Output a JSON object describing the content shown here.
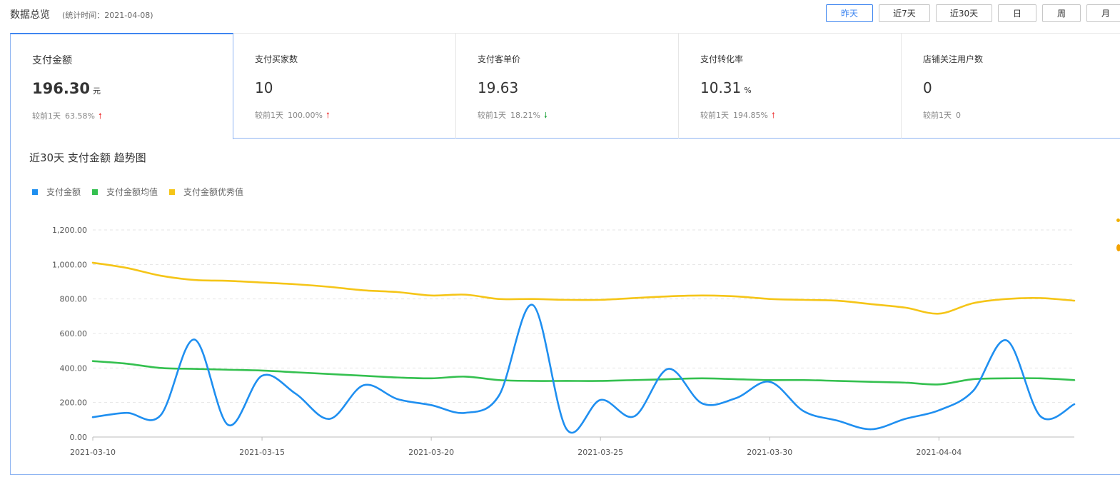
{
  "header": {
    "title": "数据总览",
    "subtitle": "(统计时间：2021-04-08)"
  },
  "range_buttons": [
    {
      "label": "昨天",
      "active": true
    },
    {
      "label": "近7天",
      "active": false
    },
    {
      "label": "近30天",
      "active": false
    },
    {
      "label": "日",
      "active": false
    },
    {
      "label": "周",
      "active": false
    },
    {
      "label": "月",
      "active": false
    }
  ],
  "metrics": [
    {
      "label": "支付金额",
      "value": "196.30",
      "unit": "元",
      "compare_label": "较前1天",
      "compare_value": "63.58%",
      "trend": "up",
      "active": true
    },
    {
      "label": "支付买家数",
      "value": "10",
      "unit": "",
      "compare_label": "较前1天",
      "compare_value": "100.00%",
      "trend": "up",
      "active": false
    },
    {
      "label": "支付客单价",
      "value": "19.63",
      "unit": "",
      "compare_label": "较前1天",
      "compare_value": "18.21%",
      "trend": "down",
      "active": false
    },
    {
      "label": "支付转化率",
      "value": "10.31",
      "unit": "%",
      "compare_label": "较前1天",
      "compare_value": "194.85%",
      "trend": "up",
      "active": false
    },
    {
      "label": "店铺关注用户数",
      "value": "0",
      "unit": "",
      "compare_label": "较前1天",
      "compare_value": "0",
      "trend": "none",
      "active": false
    }
  ],
  "icons": {
    "trend_up": "arrow-up-icon",
    "trend_down": "arrow-down-icon",
    "next": "chevron-right-icon"
  },
  "colors": {
    "accent": "#3f86f0",
    "up": "#f04b4b",
    "down": "#28a745"
  },
  "chart_data": {
    "type": "line",
    "title": "近30天 支付金额 趋势图",
    "xlabel": "",
    "ylabel": "",
    "ylim": [
      0,
      1200
    ],
    "grid": true,
    "legend_position": "top-left",
    "x": [
      "2021-03-10",
      "2021-03-11",
      "2021-03-12",
      "2021-03-13",
      "2021-03-14",
      "2021-03-15",
      "2021-03-16",
      "2021-03-17",
      "2021-03-18",
      "2021-03-19",
      "2021-03-20",
      "2021-03-21",
      "2021-03-22",
      "2021-03-23",
      "2021-03-24",
      "2021-03-25",
      "2021-03-26",
      "2021-03-27",
      "2021-03-28",
      "2021-03-29",
      "2021-03-30",
      "2021-03-31",
      "2021-04-01",
      "2021-04-02",
      "2021-04-03",
      "2021-04-04",
      "2021-04-05",
      "2021-04-06",
      "2021-04-07",
      "2021-04-08"
    ],
    "x_ticks": [
      "2021-03-10",
      "2021-03-15",
      "2021-03-20",
      "2021-03-25",
      "2021-03-30",
      "2021-04-04"
    ],
    "y_ticks": [
      "0.00",
      "200.00",
      "400.00",
      "600.00",
      "800.00",
      "1,000.00",
      "1,200.00"
    ],
    "y_tick_values": [
      0,
      200,
      400,
      600,
      800,
      1000,
      1200
    ],
    "series": [
      {
        "name": "支付金额",
        "color": "#1f8ff0",
        "values": [
          115,
          140,
          125,
          565,
          70,
          355,
          250,
          105,
          300,
          220,
          185,
          140,
          240,
          765,
          45,
          215,
          120,
          395,
          195,
          225,
          320,
          150,
          95,
          45,
          105,
          155,
          265,
          560,
          120,
          190
        ]
      },
      {
        "name": "支付金额均值",
        "color": "#34c04f",
        "values": [
          440,
          425,
          400,
          395,
          390,
          385,
          375,
          365,
          355,
          345,
          340,
          350,
          330,
          325,
          325,
          325,
          330,
          335,
          340,
          335,
          330,
          330,
          325,
          320,
          315,
          305,
          335,
          340,
          340,
          330
        ]
      },
      {
        "name": "支付金额优秀值",
        "color": "#f5c518",
        "values": [
          1010,
          980,
          935,
          910,
          905,
          895,
          885,
          870,
          850,
          840,
          820,
          825,
          800,
          800,
          795,
          795,
          805,
          815,
          820,
          815,
          800,
          795,
          790,
          770,
          750,
          715,
          775,
          800,
          805,
          790
        ]
      }
    ]
  }
}
